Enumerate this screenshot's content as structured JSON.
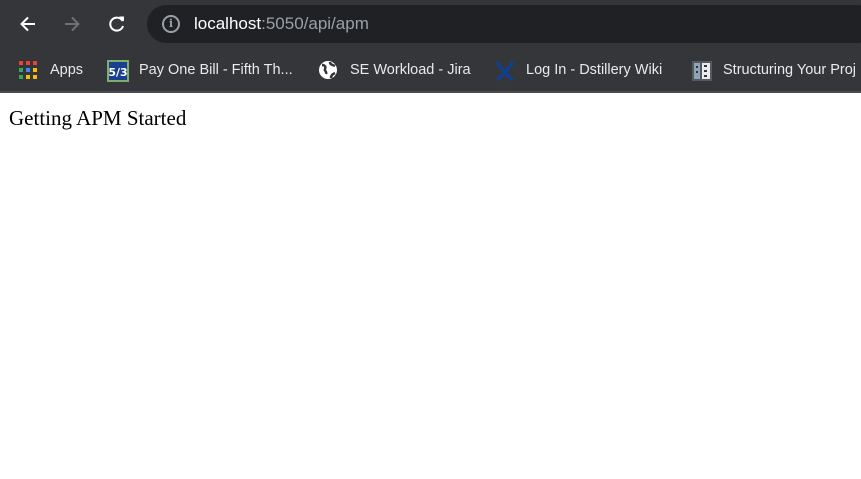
{
  "browser": {
    "url_host": "localhost",
    "url_rest": ":5050/api/apm",
    "bookmarks": [
      {
        "label": "Apps",
        "icon": "apps-grid-icon"
      },
      {
        "label": "Pay One Bill - Fifth Th...",
        "icon": "fifth-third-icon"
      },
      {
        "label": "SE Workload - Jira",
        "icon": "globe-icon"
      },
      {
        "label": "Log In - Dstillery Wiki",
        "icon": "confluence-icon"
      },
      {
        "label": "Structuring Your Proj",
        "icon": "book-icon"
      }
    ],
    "colors": {
      "toolbar": "#35363a",
      "omnibox": "#202124"
    }
  },
  "page": {
    "text": "Getting APM Started"
  }
}
